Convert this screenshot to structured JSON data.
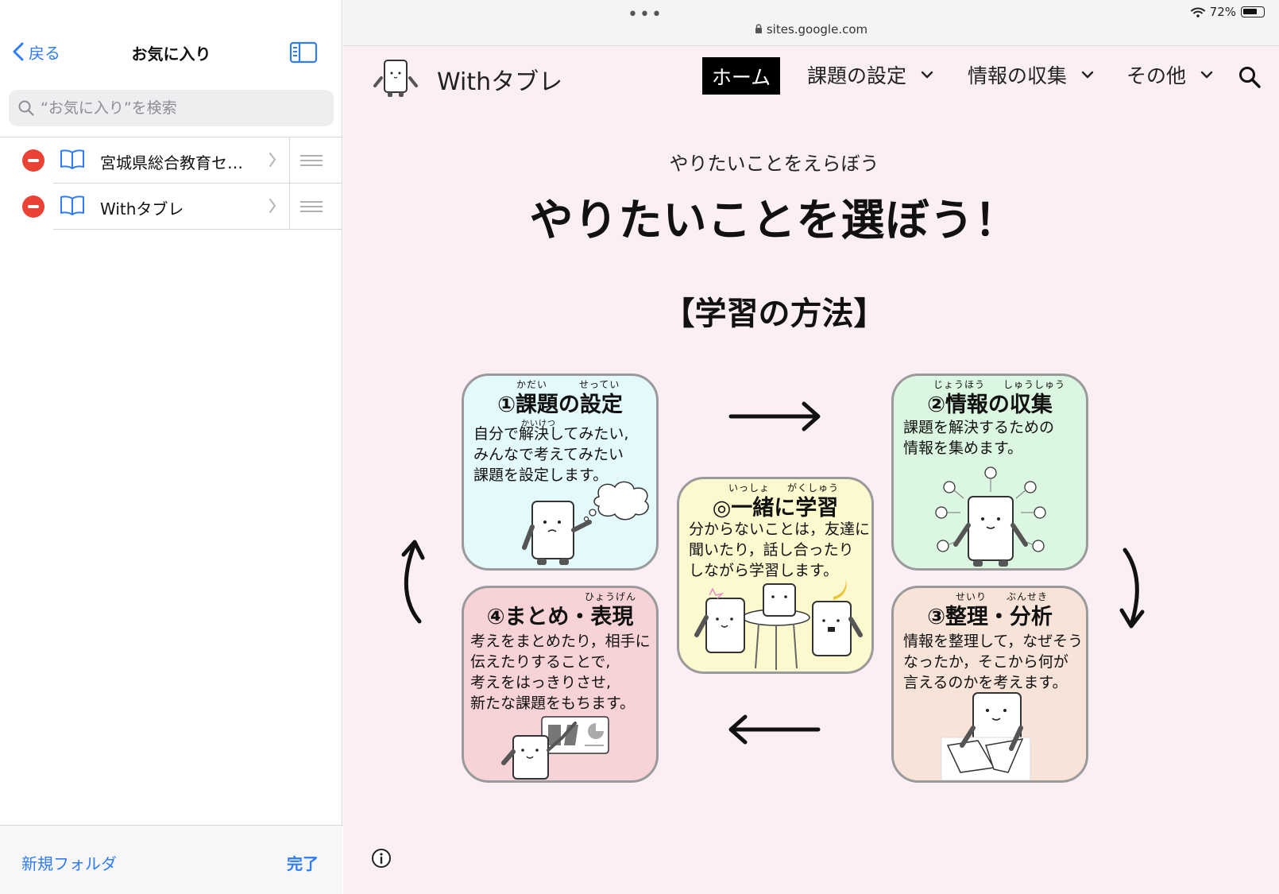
{
  "sidebar": {
    "back_label": "戻る",
    "title": "お気に入り",
    "search_placeholder": "“お気に入り”を検索",
    "bookmarks": [
      {
        "label": "宮城県総合教育セ…"
      },
      {
        "label": "Withタブレ"
      }
    ],
    "new_folder_label": "新規フォルダ",
    "done_label": "完了"
  },
  "browser": {
    "url": "sites.google.com",
    "battery_percent": "72%",
    "battery_level": 0.72
  },
  "site": {
    "name": "Withタブレ",
    "nav": {
      "home": "ホーム",
      "items": [
        "課題の設定",
        "情報の収集",
        "その他"
      ]
    }
  },
  "content": {
    "small_heading": "やりたいことをえらぼう",
    "headline": "やりたいことを選ぼう！",
    "method_title": "【学習の方法】"
  },
  "cycle": {
    "card1": {
      "ruby1": "かだい",
      "ruby2": "せってい",
      "title": "①課題の設定",
      "ruby3": "かいけつ",
      "lines": [
        "自分で解決してみたい,",
        "みんなで考えてみたい",
        "課題を設定します。"
      ],
      "color": "#e3f9fb"
    },
    "card2": {
      "ruby1": "じょうほう",
      "ruby2": "しゅうしゅう",
      "title": "②情報の収集",
      "lines": [
        "課題を解決するための",
        "情報を集めます。"
      ],
      "color": "#dcf7e1"
    },
    "card3": {
      "ruby1": "せいり",
      "ruby2": "ぶんせき",
      "title": "③整理・分析",
      "lines": [
        "情報を整理して，なぜそう",
        "なったか，そこから何が",
        "言えるのかを考えます。"
      ],
      "color": "#f7e3d7"
    },
    "card4": {
      "ruby1": "ひょうげん",
      "title": "④まとめ・表現",
      "lines": [
        "考えをまとめたり，相手に",
        "伝えたりすることで,",
        "考えをはっきりさせ,",
        "新たな課題をもちます。"
      ],
      "color": "#f7d2d6"
    },
    "center": {
      "ruby1": "いっしょ",
      "ruby2": "がくしゅう",
      "title": "◎一緒に学習",
      "lines": [
        "分からないことは，友達に",
        "聞いたり，話し合ったり",
        "しながら学習します。"
      ],
      "color": "#fdf9cf"
    }
  }
}
